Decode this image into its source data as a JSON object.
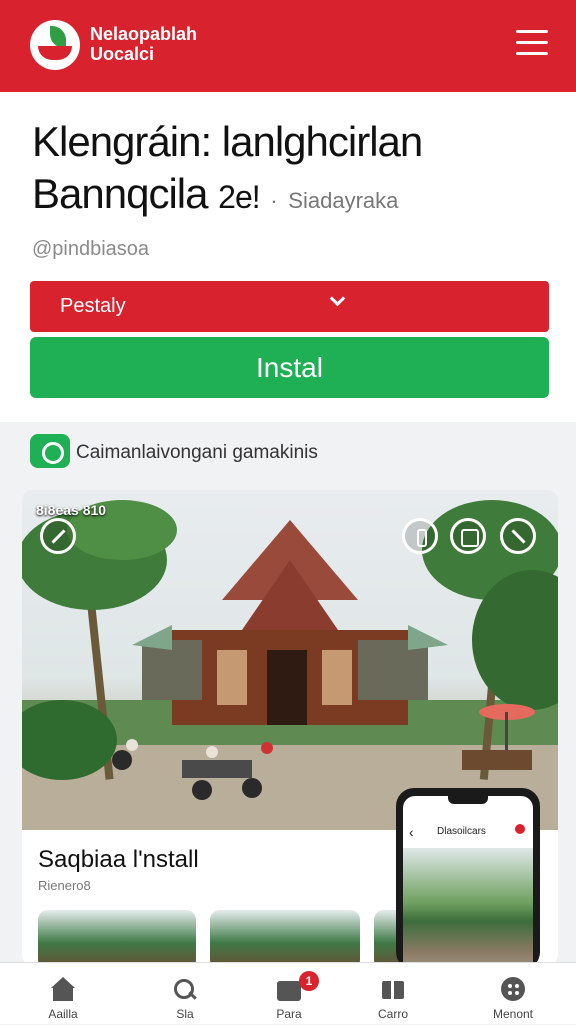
{
  "app": {
    "brand_line1": "Nelaopablah",
    "brand_line2": "Uocalci",
    "menu_icon": "hamburger-icon"
  },
  "hero": {
    "title_line1": "Klengráin: lanlghcirlan",
    "title_line2": "Bannqcila",
    "title_age": "2e!",
    "title_sep": "·",
    "title_sub": "Siadayraka",
    "handle": "@pindbiasoa"
  },
  "dropdown": {
    "label": "Pestaly",
    "icon": "chevron-down-icon"
  },
  "install_button": {
    "label": "Instal"
  },
  "section": {
    "icon": "app-badge-icon",
    "title": "Caimanlaivongani gamakinis"
  },
  "photo": {
    "badge": "8i8eas 810",
    "overlay_icons": [
      "edit-icon",
      "info-icon",
      "square-icon",
      "share-icon"
    ]
  },
  "install_section": {
    "title": "Saqbiaa l'nstall",
    "subtitle": "Rienero8"
  },
  "phone_preview": {
    "back": "‹",
    "title": "Dlasoilcars"
  },
  "tabs": [
    {
      "label": "Aailla",
      "icon": "home-icon"
    },
    {
      "label": "Sla",
      "icon": "search-icon"
    },
    {
      "label": "Para",
      "icon": "category-icon",
      "badge": "1"
    },
    {
      "label": "Carro",
      "icon": "map-icon"
    },
    {
      "label": "Menont",
      "icon": "menu-icon"
    }
  ],
  "colors": {
    "brand_red": "#d8222e",
    "install_green": "#1faf54"
  }
}
